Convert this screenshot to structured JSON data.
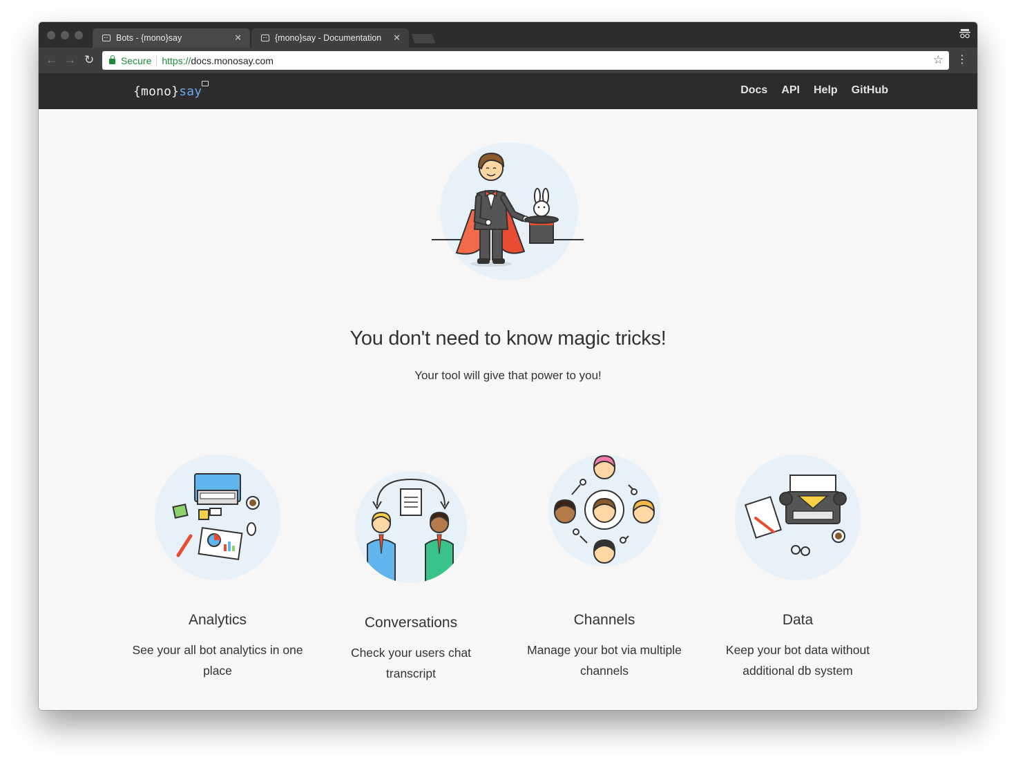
{
  "browser": {
    "tabs": [
      {
        "title": "Bots - {mono}say",
        "active": false
      },
      {
        "title": "{mono}say - Documentation",
        "active": true
      }
    ],
    "secure_label": "Secure",
    "url_scheme": "https://",
    "url_host": "docs.monosay.com"
  },
  "site": {
    "logo_mono": "{mono}",
    "logo_say": "say",
    "nav": [
      "Docs",
      "API",
      "Help",
      "GitHub"
    ]
  },
  "hero": {
    "title": "You don't need to know magic tricks!",
    "subtitle": "Your tool will give that power to you!"
  },
  "features": [
    {
      "title": "Analytics",
      "desc_line1": "See your all bot analytics in one",
      "desc_line2": "place"
    },
    {
      "title": "Conversations",
      "desc_line1": "Check your users chat",
      "desc_line2": "transcript"
    },
    {
      "title": "Channels",
      "desc_line1": "Manage your bot via multiple",
      "desc_line2": "channels"
    },
    {
      "title": "Data",
      "desc_line1": "Keep your bot data without",
      "desc_line2": "additional db system"
    }
  ],
  "colors": {
    "accent_logo": "#6aa9ec",
    "header_bg": "#2c2c2c",
    "secure_green": "#1d8a3a",
    "illustration_circle": "#e7f1fa"
  }
}
